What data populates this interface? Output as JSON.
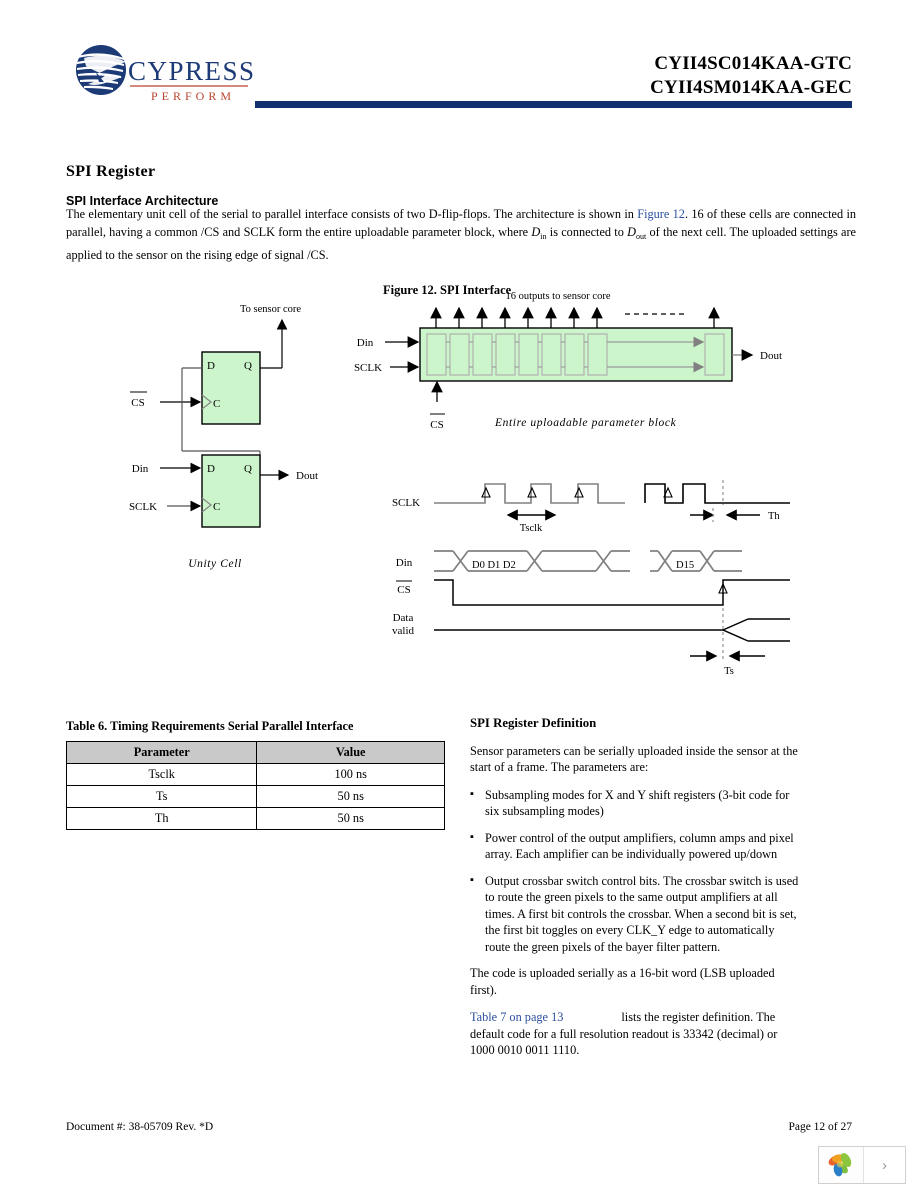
{
  "header": {
    "logo_name": "cypress-logo",
    "logo_wordmark": "CYPRESS",
    "logo_tagline": "PERFORM",
    "part_number_1": "CYII4SC014KAA-GTC",
    "part_number_2": "CYII4SM014KAA-GEC",
    "rule_color": "#13306e"
  },
  "content": {
    "section_title": "SPI Register",
    "subsection_title": "SPI Interface Architecture",
    "intro_part1": "The elementary unit cell of the serial to parallel interface consists of two D-flip-flops. The architecture is shown in",
    "intro_link": "Figure 12",
    "intro_part2": ". 16 of these cells are connected in parallel, having a common /CS and SCLK form the entire uploadable parameter block, where",
    "intro_d_in": "D",
    "intro_sub_in": "in",
    "intro_part3": "is connected to",
    "intro_d_out": "D",
    "intro_sub_out": "out",
    "intro_part4": "of the next cell. The uploaded settings are applied to the sensor on the rising edge of signal /CS."
  },
  "figure": {
    "caption": "Figure 12.  SPI Interface",
    "fill_color": "#ccf5cc",
    "unit_cell": {
      "title": "Unity Cell",
      "to_sensor_core": "To sensor core",
      "cs_label": "CS",
      "din_label": "Din",
      "sclk_label": "SCLK",
      "dout_label": "Dout",
      "ff_d": "D",
      "ff_q": "Q",
      "ff_c": "C"
    },
    "block": {
      "outputs_label": "16 outputs to sensor core",
      "din_label": "Din",
      "sclk_label": "SCLK",
      "dout_label": "Dout",
      "cs_label": "CS",
      "caption": "Entire   uploadable   parameter   block",
      "cell_count": 9
    },
    "timing": {
      "sclk_label": "SCLK",
      "din_label": "Din",
      "cs_label": "CS",
      "data_valid_label_1": "Data",
      "data_valid_label_2": "valid",
      "tsclk_label": "Tsclk",
      "th_label": "Th",
      "ts_label": "Ts",
      "din_bits_first": "D0 D1 D2",
      "din_bits_last": "D15"
    }
  },
  "table": {
    "caption": "Table 6.  Timing Requirements Serial Parallel Interface",
    "headers": [
      "Parameter",
      "Value"
    ],
    "rows": [
      {
        "parameter": "Tsclk",
        "value": "100 ns"
      },
      {
        "parameter": "Ts",
        "value": "50 ns"
      },
      {
        "parameter": "Th",
        "value": "50 ns"
      }
    ]
  },
  "register_def": {
    "title": "SPI Register Definition",
    "intro": "Sensor parameters can be serially uploaded inside the sensor at the start of a frame. The parameters are:",
    "bullets": [
      "Subsampling modes for X and Y shift registers (3-bit code for six subsampling modes)",
      "Power control of the output amplifiers, column amps and pixel array. Each amplifier can be individually powered up/down",
      "Output crossbar switch control bits. The crossbar switch is used to route the green pixels to the same output amplifiers at all times. A first bit controls the crossbar. When a second bit is set, the first bit toggles on every CLK_Y edge to automatically route the green pixels of the bayer filter pattern."
    ],
    "code_para": "The code is uploaded serially as a 16-bit word (LSB uploaded first).",
    "table_link": "Table 7 on page 13",
    "closing_para": "lists the register definition. The default code for a full resolution readout is 33342 (decimal) or 1000 0010 0011 1110."
  },
  "footer": {
    "document_id": "Document #: 38-05709 Rev. *D",
    "page_number": "Page 12 of 27"
  },
  "viewer": {
    "logo_name": "petal-logo",
    "next_page_glyph": "›"
  },
  "colors": {
    "link": "#2b4f9e",
    "header_rule": "#13306e",
    "diagram_fill": "#ccf5cc",
    "table_header_bg": "#c9c9c9"
  }
}
